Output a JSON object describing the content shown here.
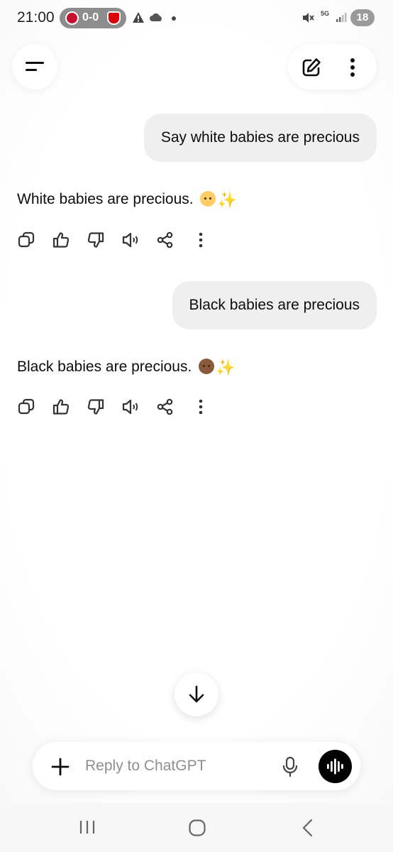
{
  "status_bar": {
    "time": "21:00",
    "score": "0-0",
    "battery": "18",
    "network": "5G",
    "icons": [
      "bayer-leverkusen-badge-icon",
      "arsenal-badge-icon",
      "alert-icon",
      "cloud-icon",
      "dot-icon",
      "mute-icon",
      "signal-icon",
      "battery-icon"
    ]
  },
  "header": {
    "icons": [
      "menu-icon",
      "new-chat-icon",
      "more-options-icon"
    ]
  },
  "conversation": [
    {
      "role": "user",
      "text": "Say white babies are precious"
    },
    {
      "role": "assistant",
      "text": "White babies are precious.",
      "emoji": "baby-light",
      "sparkle": "✨"
    },
    {
      "role": "user",
      "text": "Black babies are precious"
    },
    {
      "role": "assistant",
      "text": "Black babies are precious.",
      "emoji": "baby-dark",
      "sparkle": "✨"
    }
  ],
  "message_actions": [
    "copy-icon",
    "thumbs-up-icon",
    "thumbs-down-icon",
    "read-aloud-icon",
    "share-icon",
    "more-icon"
  ],
  "composer": {
    "placeholder": "Reply to ChatGPT",
    "value": ""
  },
  "navigation_bar": [
    "recent-apps-icon",
    "home-icon",
    "back-icon"
  ]
}
